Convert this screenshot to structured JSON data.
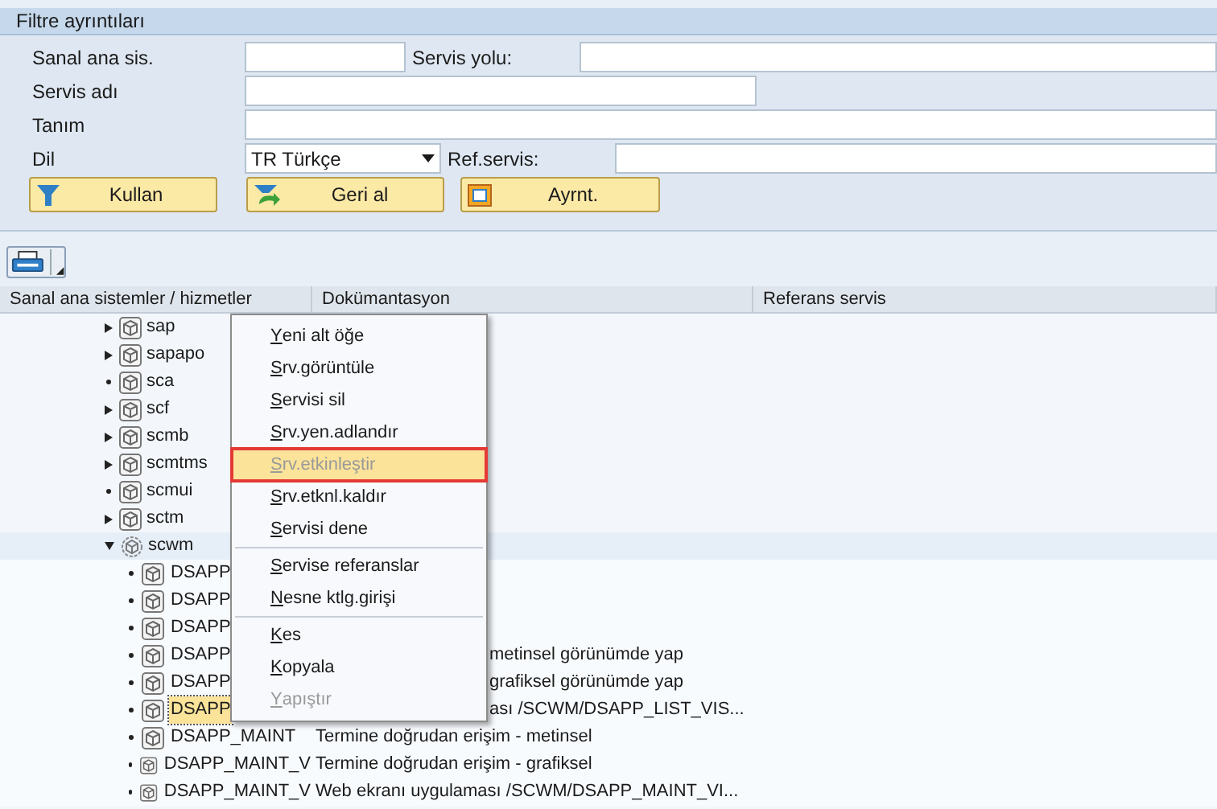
{
  "filter_panel": {
    "title": "Filtre ayrıntıları",
    "fields": [
      {
        "label": "Sanal ana sis.",
        "kind": "short"
      },
      {
        "label": "Servis yolu:",
        "kind": "side"
      },
      {
        "label": "Servis adı",
        "kind": "medium"
      },
      {
        "label": "Tanım",
        "kind": "wide"
      },
      {
        "label": "Dil",
        "kind": "dropdown",
        "value": "TR Türkçe"
      },
      {
        "label": "Ref.servis:",
        "kind": "side"
      }
    ],
    "buttons": [
      {
        "label": "Kullan",
        "kind": "filter"
      },
      {
        "label": "Geri al",
        "kind": "undo"
      },
      {
        "label": "Ayrnt.",
        "kind": "details"
      }
    ]
  },
  "tree": {
    "columns": [
      "Sanal ana sistemler / hizmetler",
      "Dokümantasyon",
      "Referans servis"
    ],
    "rows": [
      {
        "name": "sap",
        "kind": "node",
        "expanded": false
      },
      {
        "name": "sapapo",
        "kind": "node",
        "expanded": false
      },
      {
        "name": "sca",
        "kind": "leaf"
      },
      {
        "name": "scf",
        "kind": "node",
        "expanded": false
      },
      {
        "name": "scmb",
        "kind": "node",
        "expanded": false
      },
      {
        "name": "scmtms",
        "kind": "node",
        "expanded": false
      },
      {
        "name": "scmui",
        "kind": "leaf"
      },
      {
        "name": "sctm",
        "kind": "node",
        "expanded": false
      },
      {
        "name": "scwm",
        "kind": "node",
        "expanded": true,
        "children": [
          {
            "name": "DSAPP",
            "selected": false
          },
          {
            "name": "DSAPP",
            "selected": false
          },
          {
            "name": "DSAPP",
            "selected": false
          },
          {
            "name": "DSAPP",
            "doc": "metinsel görünümde yap",
            "kind": "covered",
            "selected": false
          },
          {
            "name": "DSAPP",
            "doc": "grafiksel görünümde yap",
            "kind": "covered",
            "selected": false
          },
          {
            "name": "DSAPP",
            "doc": "ası /SCWM/DSAPP_LIST_VIS...",
            "kind": "covered",
            "selected": true
          },
          {
            "name": "DSAPP_MAINT",
            "doc": "Termine doğrudan erişim - metinsel",
            "selected": false
          },
          {
            "name": "DSAPP_MAINT_V",
            "doc": "Termine doğrudan erişim - grafiksel",
            "selected": false
          },
          {
            "name": "DSAPP_MAINT_V",
            "doc": "Web ekranı uygulaması /SCWM/DSAPP_MAINT_VI...",
            "selected": false
          }
        ]
      }
    ]
  },
  "context_menu": {
    "groups": [
      [
        {
          "label": "Yeni alt öğe",
          "disabled": false,
          "selected": false
        },
        {
          "label": "Srv.görüntüle",
          "disabled": false,
          "selected": false
        },
        {
          "label": "Servisi sil",
          "disabled": false,
          "selected": false
        },
        {
          "label": "Srv.yen.adlandır",
          "disabled": false,
          "selected": false
        },
        {
          "label": "Srv.etkinleştir",
          "disabled": true,
          "selected": true
        },
        {
          "label": "Srv.etknl.kaldır",
          "disabled": false,
          "selected": false
        },
        {
          "label": "Servisi dene",
          "disabled": false,
          "selected": false
        }
      ],
      [
        {
          "label": "Servise referanslar",
          "disabled": false,
          "selected": false
        },
        {
          "label": "Nesne ktlg.girişi",
          "disabled": false,
          "selected": false
        }
      ],
      [
        {
          "label": "Kes",
          "disabled": false,
          "selected": false
        },
        {
          "label": "Kopyala",
          "disabled": false,
          "selected": false
        },
        {
          "label": "Yapıştır",
          "disabled": true,
          "selected": false
        }
      ]
    ]
  }
}
